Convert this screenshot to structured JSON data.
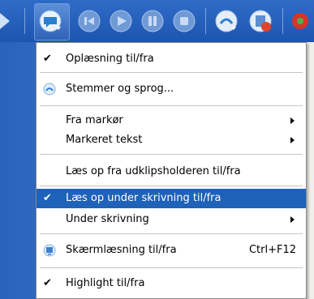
{
  "menu": {
    "items": [
      {
        "label": "Oplæsning til/fra",
        "checked": true
      },
      {
        "label": "Stemmer og sprog...",
        "icon": "voices-icon"
      },
      {
        "label": "Fra markør",
        "submenu": true
      },
      {
        "label": "Markeret tekst",
        "submenu": true
      },
      {
        "label": "Læs op fra udklipsholderen til/fra"
      },
      {
        "label": "Læs op under skrivning til/fra",
        "checked": true,
        "selected": true
      },
      {
        "label": "Under skrivning",
        "submenu": true
      },
      {
        "label": "Skærmlæsning til/fra",
        "shortcut": "Ctrl+F12",
        "icon": "screen-reader-icon"
      },
      {
        "label": "Highlight til/fra",
        "checked": true
      }
    ]
  },
  "toolbar": {
    "icons": [
      "speak-icon",
      "previous-icon",
      "play-icon",
      "pause-icon",
      "stop-icon",
      "voices-icon",
      "stop-reading-icon"
    ]
  },
  "colors": {
    "accent": "#1e62b9",
    "toolbar": "#2160bd"
  }
}
